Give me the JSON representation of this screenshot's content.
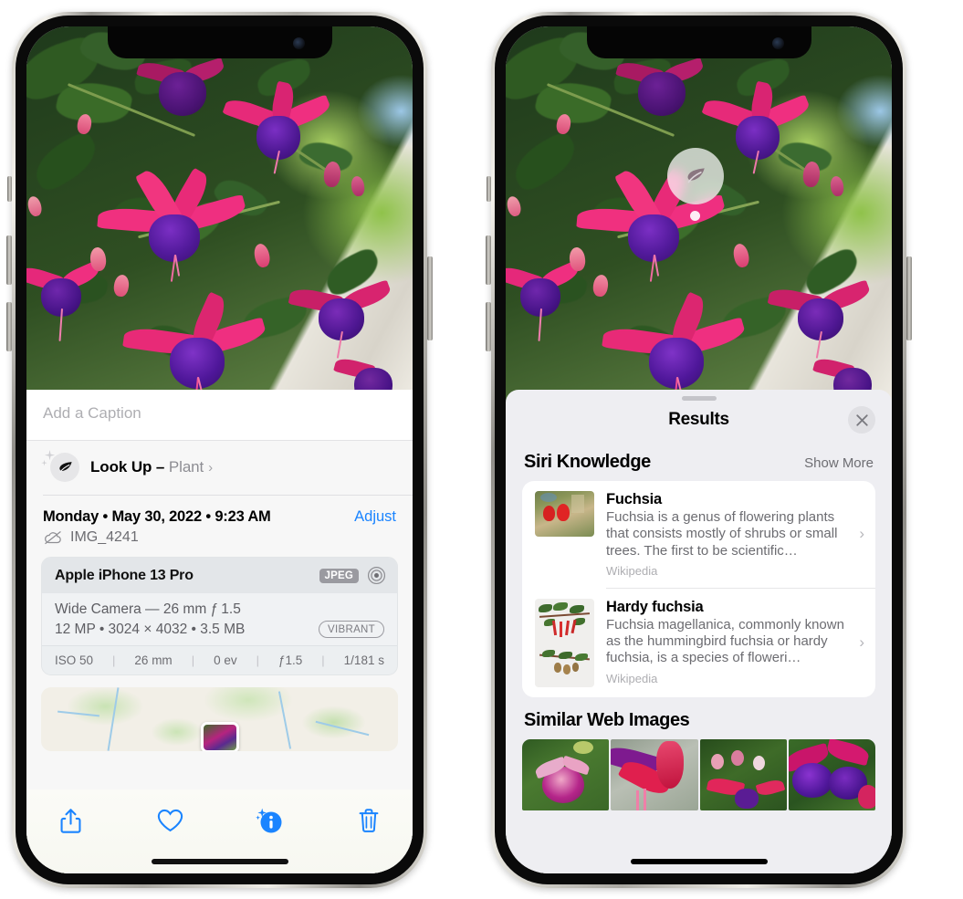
{
  "left_phone": {
    "caption": {
      "placeholder": "Add a Caption",
      "value": ""
    },
    "lookup": {
      "icon": "leaf-icon",
      "label": "Look Up",
      "dash": " – ",
      "subject": "Plant",
      "chevron": "›"
    },
    "date_row": {
      "date_text": "Monday • May 30, 2022 • 9:23 AM",
      "adjust_label": "Adjust"
    },
    "file_row": {
      "icon": "cloud-slash-icon",
      "file_name": "IMG_4241"
    },
    "camera_card": {
      "device": "Apple iPhone 13 Pro",
      "format_badge": "JPEG",
      "raw_icon": "aperture-icon",
      "lens_line": "Wide Camera — 26 mm ƒ 1.5",
      "specs_line": "12 MP • 3024 × 4032 • 3.5 MB",
      "style_badge": "VIBRANT",
      "exif": [
        "ISO 50",
        "26 mm",
        "0 ev",
        "ƒ1.5",
        "1/181 s"
      ]
    },
    "toolbar": [
      {
        "name": "share-button",
        "icon": "share-icon"
      },
      {
        "name": "favorite-button",
        "icon": "heart-icon"
      },
      {
        "name": "info-button",
        "icon": "info-sparkle-icon"
      },
      {
        "name": "delete-button",
        "icon": "trash-icon"
      }
    ],
    "accent_color": "#1a84ff"
  },
  "right_phone": {
    "leaf_badge": {
      "icon": "leaf-icon"
    },
    "sheet": {
      "title": "Results",
      "close_icon": "close-icon"
    },
    "siri_knowledge": {
      "section_title": "Siri Knowledge",
      "show_more": "Show More",
      "items": [
        {
          "title": "Fuchsia",
          "description": "Fuchsia is a genus of flowering plants that consists mostly of shrubs or small trees. The first to be scientific…",
          "source": "Wikipedia",
          "thumb": "fuchsia-red-flowers-thumb",
          "chevron": "›"
        },
        {
          "title": "Hardy fuchsia",
          "description": "Fuchsia magellanica, commonly known as the hummingbird fuchsia or hardy fuchsia, is a species of floweri…",
          "source": "Wikipedia",
          "thumb": "hardy-fuchsia-herbarium-thumb",
          "chevron": "›"
        }
      ]
    },
    "similar_web_images": {
      "section_title": "Similar Web Images",
      "items": [
        {
          "name": "web-image-1"
        },
        {
          "name": "web-image-2"
        },
        {
          "name": "web-image-3"
        },
        {
          "name": "web-image-4"
        }
      ]
    }
  }
}
